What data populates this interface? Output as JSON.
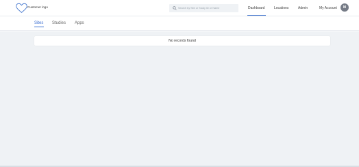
{
  "brand": {
    "logo_icon": "heart-outline-icon",
    "logo_text": "Customer logo"
  },
  "search": {
    "icon": "search-icon",
    "placeholder": "Search by Site or Study ID or Name"
  },
  "nav": {
    "items": [
      {
        "label": "Dashboard",
        "active": true
      },
      {
        "label": "Locations",
        "active": false
      },
      {
        "label": "Admin",
        "active": false
      },
      {
        "label": "My Account",
        "active": false
      }
    ],
    "avatar_initial": "M"
  },
  "tabs": [
    {
      "label": "Sites",
      "active": true
    },
    {
      "label": "Studies",
      "active": false
    },
    {
      "label": "Apps",
      "active": false
    }
  ],
  "results": {
    "empty_message": "No records found"
  },
  "colors": {
    "accent": "#3b6fd2",
    "background": "#eff2f5",
    "avatar": "#757b86"
  }
}
